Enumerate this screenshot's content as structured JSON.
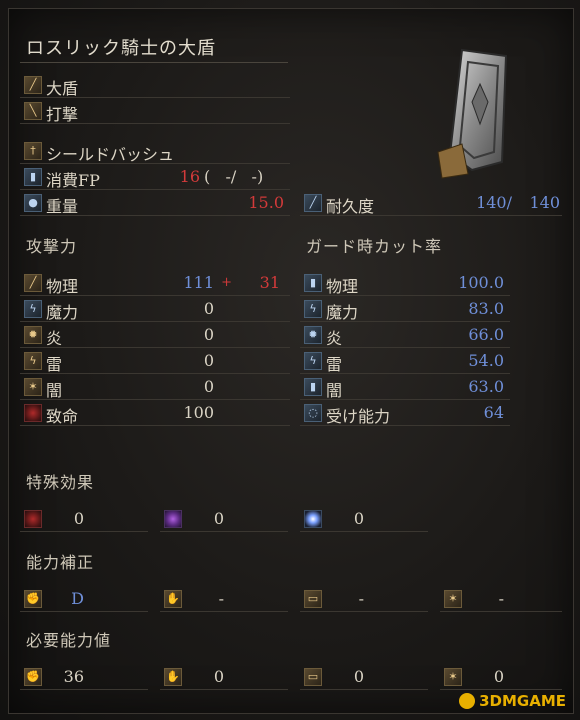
{
  "item_name": "ロスリック騎士の大盾",
  "category": "大盾",
  "attack_type": "打撃",
  "skill": "シールドバッシュ",
  "fp_label": "消費FP",
  "fp_cost": "16",
  "fp_rest": "(   -/   -)",
  "weight_label": "重量",
  "weight": "15.0",
  "durability_label": "耐久度",
  "durability_cur": "140/",
  "durability_max": "140",
  "attack_section": "攻撃力",
  "attack": [
    {
      "label": "物理",
      "value": "111",
      "bonus_sign": "+",
      "bonus": "31"
    },
    {
      "label": "魔力",
      "value": "0"
    },
    {
      "label": "炎",
      "value": "0"
    },
    {
      "label": "雷",
      "value": "0"
    },
    {
      "label": "闇",
      "value": "0"
    },
    {
      "label": "致命",
      "value": "100"
    }
  ],
  "guard_section": "ガード時カット率",
  "guard": [
    {
      "label": "物理",
      "value": "100.0"
    },
    {
      "label": "魔力",
      "value": "83.0"
    },
    {
      "label": "炎",
      "value": "66.0"
    },
    {
      "label": "雷",
      "value": "54.0"
    },
    {
      "label": "闇",
      "value": "63.0"
    },
    {
      "label": "受け能力",
      "value": "64"
    }
  ],
  "special_section": "特殊効果",
  "special": [
    "0",
    "0",
    "0"
  ],
  "scaling_section": "能力補正",
  "scaling": [
    "D",
    "-",
    "-",
    "-"
  ],
  "req_section": "必要能力値",
  "requirements": [
    "36",
    "0",
    "0",
    "0"
  ],
  "watermark": "3DMGAME",
  "icons": {
    "category": "shield-icon",
    "attack_type": "strike-icon",
    "skill": "skill-icon",
    "fp": "fp-icon",
    "weight": "weight-icon",
    "durability": "durability-icon",
    "special": [
      "bleed-icon",
      "poison-icon",
      "frost-icon"
    ],
    "stats": [
      "strength-icon",
      "dexterity-icon",
      "intelligence-icon",
      "faith-icon"
    ]
  },
  "colors": {
    "value_blue": "#6f8fd8",
    "value_red": "#d23a3a",
    "text": "#d9d3c4"
  }
}
